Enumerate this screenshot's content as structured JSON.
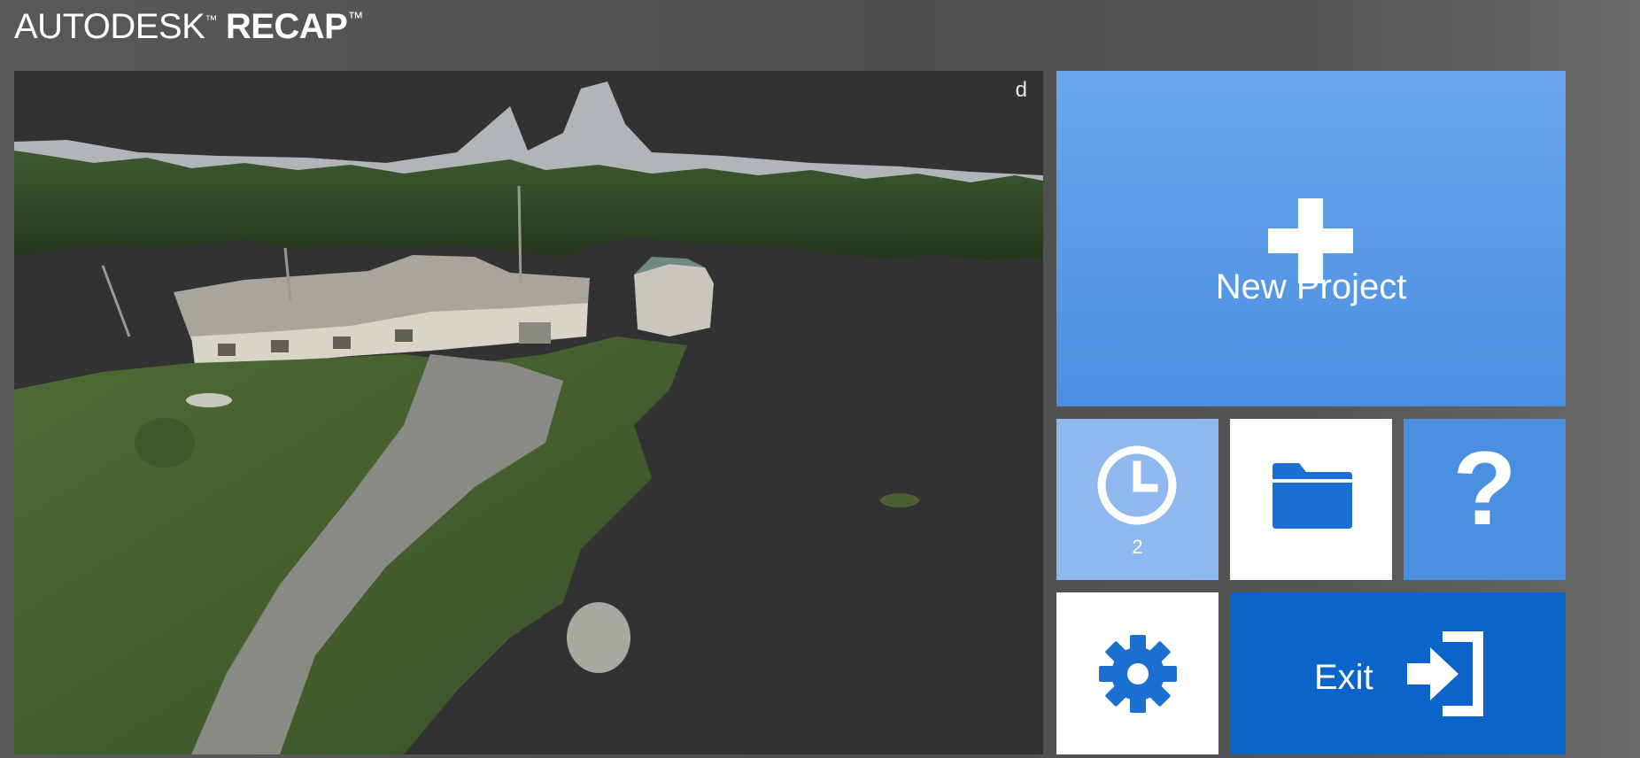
{
  "app": {
    "brand": "AUTODESK",
    "product": "RECAP",
    "trademark": "™"
  },
  "viewport": {
    "corner_letter": "d",
    "description_icon": "3d-point-cloud-scan"
  },
  "tiles": {
    "new_project": {
      "label": "New Project",
      "icon": "plus-icon",
      "color": "#5b9be8"
    },
    "recent": {
      "icon": "clock-icon",
      "count": "2",
      "color": "#8fb9ee"
    },
    "open": {
      "icon": "folder-icon",
      "color": "#ffffff"
    },
    "help": {
      "glyph": "?",
      "icon": "help-icon",
      "color": "#4a8fe0"
    },
    "settings": {
      "icon": "gear-icon",
      "color": "#ffffff"
    },
    "exit": {
      "label": "Exit",
      "icon": "exit-door-icon",
      "color": "#0a64c9"
    }
  },
  "colors": {
    "accent_blue": "#1a6fd1",
    "background": "#545454",
    "viewport_bg": "#323232"
  }
}
